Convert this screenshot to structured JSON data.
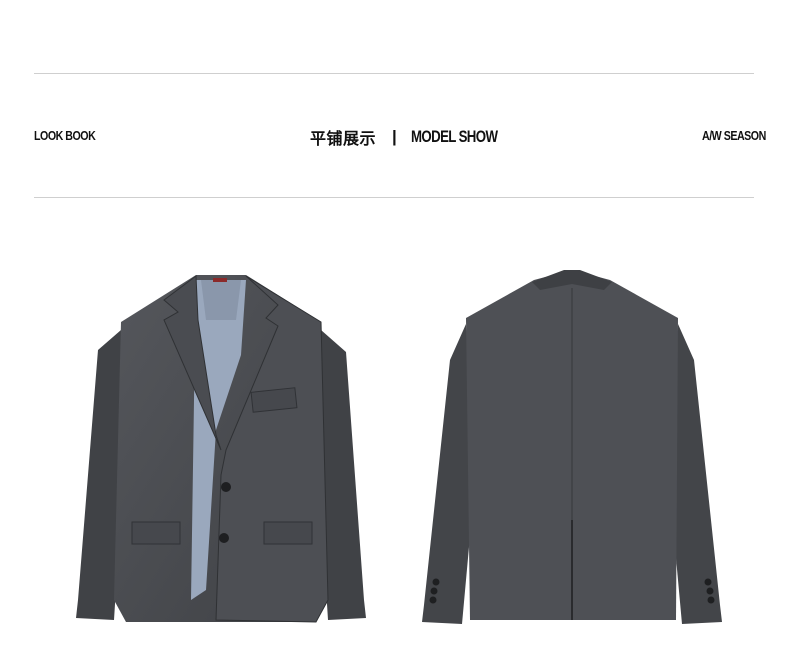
{
  "header": {
    "left_label": "LOOK BOOK",
    "center_title_zh": "平铺展示",
    "separator": "|",
    "center_title_en": "MODEL SHOW",
    "right_label": "A/W SEASON"
  },
  "colors": {
    "suit": "#4b4d52",
    "suit_dark": "#35373b",
    "lining": "#9aa8bd",
    "rule": "#cfcfcf"
  }
}
